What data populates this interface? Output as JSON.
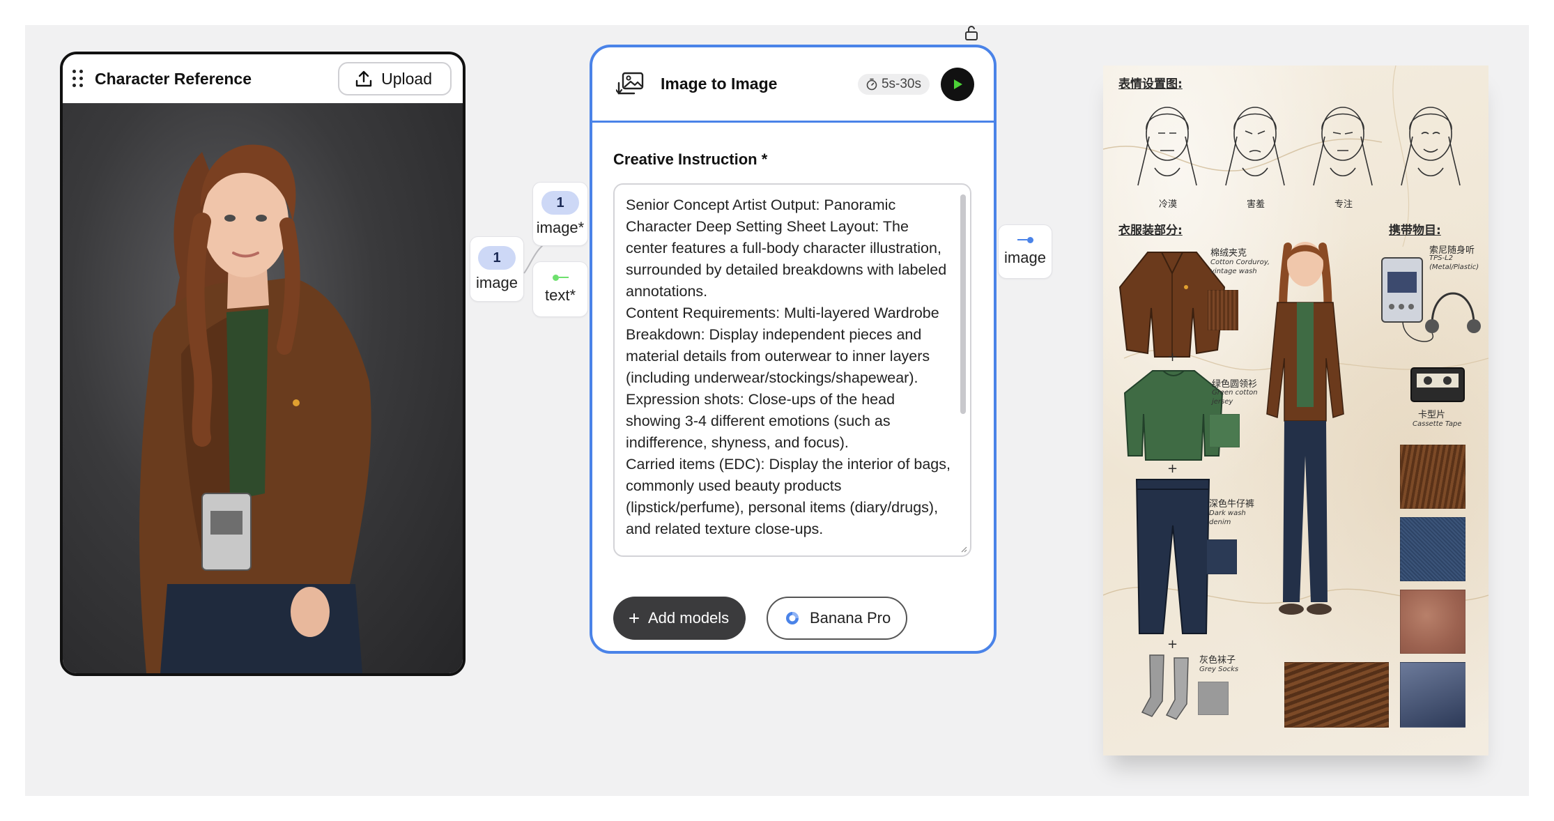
{
  "reference_card": {
    "title": "Character Reference",
    "upload_label": "Upload"
  },
  "ports": {
    "ref_output": {
      "count": "1",
      "label": "image"
    },
    "node_image_input": {
      "count": "1",
      "label": "image*"
    },
    "node_text_input": {
      "label": "text*"
    },
    "node_output": {
      "label": "image"
    }
  },
  "node": {
    "title": "Image to Image",
    "time_estimate": "5s-30s",
    "field_label": "Creative Instruction *",
    "instruction_text": "Senior Concept Artist Output: Panoramic Character Deep Setting Sheet Layout: The center features a full-body character illustration, surrounded by detailed breakdowns with labeled annotations.\nContent Requirements: Multi-layered Wardrobe Breakdown: Display independent pieces and material details from outerwear to inner layers (including underwear/stockings/shapewear).\nExpression shots: Close-ups of the head showing 3-4 different emotions (such as indifference, shyness, and focus).\nCarried items (EDC): Display the interior of bags, commonly used beauty products (lipstick/perfume), personal items (diary/drugs), and related texture close-ups.",
    "add_models_label": "Add models",
    "model_name": "Banana Pro"
  },
  "sheet": {
    "expressions_title": "表情设置图:",
    "expressions": [
      "冷漠",
      "害羞",
      "专注",
      ""
    ],
    "wardrobe_title": "衣服装部分:",
    "edc_title": "携带物目:",
    "items": {
      "jacket": {
        "cn": "棉绒夹克",
        "en": "Cotton Corduroy, vintage wash"
      },
      "sweater": {
        "cn": "绿色圆领衫",
        "en": "Green cotton jersey"
      },
      "jeans": {
        "cn": "深色牛仔裤",
        "en": "Dark wash denim"
      },
      "socks": {
        "cn": "灰色袜子",
        "en": "Grey Socks"
      },
      "walkman": {
        "cn": "索尼随身听",
        "en": "TPS-L2 (Metal/Plastic)"
      },
      "cassette": {
        "cn": "卡型片",
        "en": "Cassette Tape"
      }
    },
    "plus": "+"
  },
  "colors": {
    "node_border": "#4a83e8",
    "badge_bg": "#cdd8f6",
    "run_icon": "#4cd137",
    "text_port_dot": "#6ee06e",
    "output_port_dot": "#4a83e8"
  }
}
